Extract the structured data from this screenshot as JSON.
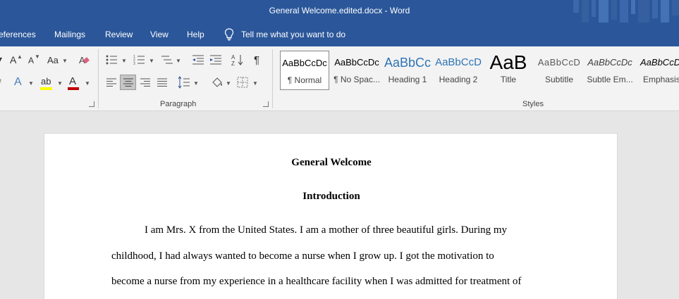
{
  "window": {
    "title": "General Welcome.edited.docx  -  Word"
  },
  "menu": {
    "tabs": [
      {
        "label": "eferences"
      },
      {
        "label": "Mailings"
      },
      {
        "label": "Review"
      },
      {
        "label": "View"
      },
      {
        "label": "Help"
      }
    ],
    "tell_me": "Tell me what you want to do"
  },
  "ribbon": {
    "font_group": {
      "grow_font": "A",
      "shrink_font": "A",
      "change_case": "Aa",
      "text_effects": "A",
      "highlight": "ab",
      "font_color": "A",
      "highlight_color": "#ffff00",
      "font_color_bar": "#c00000"
    },
    "paragraph_group": {
      "label": "Paragraph",
      "show_marks": "¶"
    },
    "styles_group": {
      "label": "Styles",
      "items": [
        {
          "preview": "AaBbCcDc",
          "name": "¶ Normal",
          "selected": true
        },
        {
          "preview": "AaBbCcDc",
          "name": "¶ No Spac..."
        },
        {
          "preview": "AaBbCc",
          "name": "Heading 1"
        },
        {
          "preview": "AaBbCcD",
          "name": "Heading 2"
        },
        {
          "preview": "AaB",
          "name": "Title"
        },
        {
          "preview": "AaBbCcD",
          "name": "Subtitle"
        },
        {
          "preview": "AaBbCcDc",
          "name": "Subtle Em..."
        },
        {
          "preview": "AaBbCcDc",
          "name": "Emphasis"
        }
      ]
    }
  },
  "document": {
    "heading": "General Welcome",
    "subheading": "Introduction",
    "lines": [
      "I am Mrs. X from the United States. I am a mother of three beautiful girls. During my",
      "childhood, I had always wanted to become a nurse when I grow up. I got the motivation to",
      "become a nurse from my experience in a healthcare facility when I was admitted for treatment of"
    ]
  },
  "colors": {
    "accent": "#2b579a",
    "heading1_blue": "#2e74b5",
    "heading2_blue": "#2e74b5"
  }
}
